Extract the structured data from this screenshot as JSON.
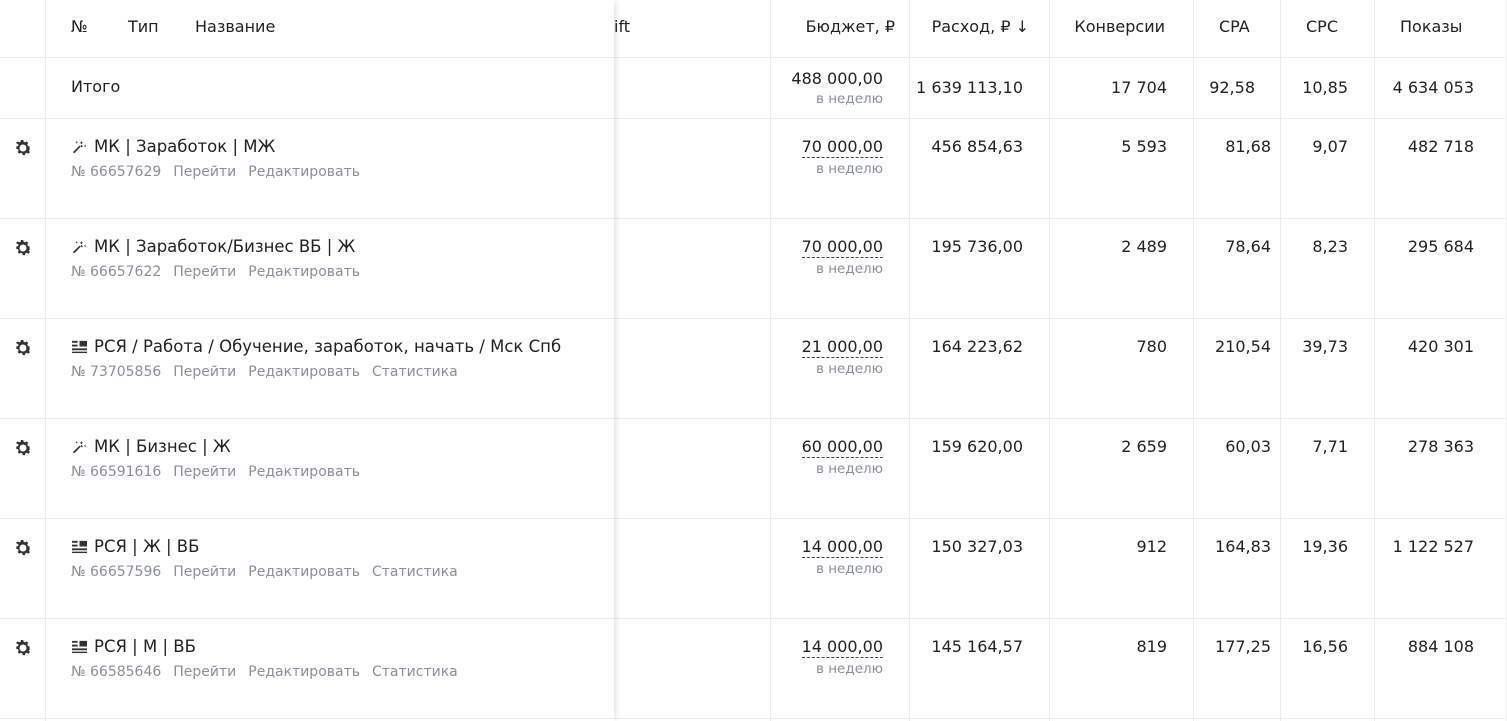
{
  "header": {
    "num": "№",
    "type": "Тип",
    "name": "Название",
    "hidden_col_tail": "ift",
    "budget": "Бюджет, ₽",
    "spend": "Расход, ₽ ↓",
    "conversions": "Конверсии",
    "cpa": "CPA",
    "cpc": "CPC",
    "impressions": "Показы"
  },
  "total": {
    "label": "Итого",
    "budget": "488 000,00",
    "budget_period": "в неделю",
    "spend": "1 639 113,10",
    "conversions": "17 704",
    "cpa": "92,58",
    "cpc": "10,85",
    "impressions": "4 634 053"
  },
  "rows": [
    {
      "icon": "master-campaign-icon",
      "title": "МК | Заработок | МЖ",
      "id": "№ 66657629",
      "go": "Перейти",
      "edit": "Редактировать",
      "stats": "",
      "budget": "70 000,00",
      "budget_period": "в неделю",
      "spend": "456 854,63",
      "conversions": "5 593",
      "cpa": "81,68",
      "cpc": "9,07",
      "impressions": "482 718"
    },
    {
      "icon": "master-campaign-icon",
      "title": "МК | Заработок/Бизнес ВБ | Ж",
      "id": "№ 66657622",
      "go": "Перейти",
      "edit": "Редактировать",
      "stats": "",
      "budget": "70 000,00",
      "budget_period": "в неделю",
      "spend": "195 736,00",
      "conversions": "2 489",
      "cpa": "78,64",
      "cpc": "8,23",
      "impressions": "295 684"
    },
    {
      "icon": "network-campaign-icon",
      "title": "РСЯ / Работа / Обучение, заработок, начать / Мск Спб",
      "id": "№ 73705856",
      "go": "Перейти",
      "edit": "Редактировать",
      "stats": "Статистика",
      "budget": "21 000,00",
      "budget_period": "в неделю",
      "spend": "164 223,62",
      "conversions": "780",
      "cpa": "210,54",
      "cpc": "39,73",
      "impressions": "420 301"
    },
    {
      "icon": "master-campaign-icon",
      "title": "МК | Бизнес | Ж",
      "id": "№ 66591616",
      "go": "Перейти",
      "edit": "Редактировать",
      "stats": "",
      "budget": "60 000,00",
      "budget_period": "в неделю",
      "spend": "159 620,00",
      "conversions": "2 659",
      "cpa": "60,03",
      "cpc": "7,71",
      "impressions": "278 363"
    },
    {
      "icon": "network-campaign-icon",
      "title": "РСЯ | Ж | ВБ",
      "id": "№ 66657596",
      "go": "Перейти",
      "edit": "Редактировать",
      "stats": "Статистика",
      "budget": "14 000,00",
      "budget_period": "в неделю",
      "spend": "150 327,03",
      "conversions": "912",
      "cpa": "164,83",
      "cpc": "19,36",
      "impressions": "1 122 527"
    },
    {
      "icon": "network-campaign-icon",
      "title": "РСЯ | М | ВБ",
      "id": "№ 66585646",
      "go": "Перейти",
      "edit": "Редактировать",
      "stats": "Статистика",
      "budget": "14 000,00",
      "budget_period": "в неделю",
      "spend": "145 164,57",
      "conversions": "819",
      "cpa": "177,25",
      "cpc": "16,56",
      "impressions": "884 108"
    }
  ]
}
